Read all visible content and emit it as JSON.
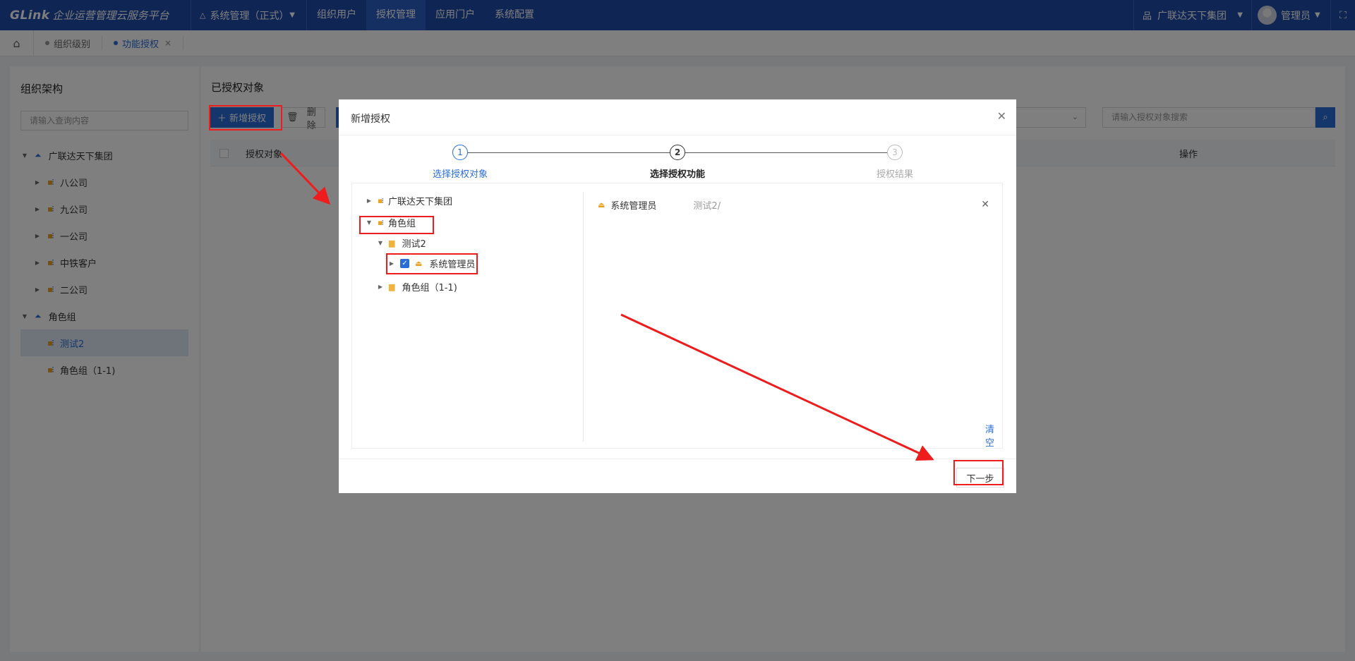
{
  "app": {
    "logo_mark": "GLink",
    "logo_text": "企业运营管理云服务平台",
    "system_select": "系统管理（正式）",
    "nav": [
      "组织用户",
      "授权管理",
      "应用门户",
      "系统配置"
    ],
    "org_switch": "广联达天下集团",
    "user": "管理员"
  },
  "tabs": [
    {
      "label": "组织级别"
    },
    {
      "label": "功能授权",
      "close": "×"
    }
  ],
  "left": {
    "title": "组织架构",
    "search_placeholder": "请输入查询内容",
    "tree": [
      {
        "label": "广联达天下集团"
      },
      {
        "label": "八公司"
      },
      {
        "label": "九公司"
      },
      {
        "label": "一公司"
      },
      {
        "label": "中铁客户"
      },
      {
        "label": "二公司"
      },
      {
        "label": "角色组"
      },
      {
        "label": "测试2"
      },
      {
        "label": "角色组（1-1)"
      }
    ]
  },
  "main": {
    "title": "已授权对象",
    "add_button": "＋ 新增授权",
    "delete_button": "删除",
    "search_placeholder": "请输入授权对象搜索",
    "col_object": "授权对象",
    "col_action": "操作"
  },
  "modal": {
    "title": "新增授权",
    "steps": [
      {
        "num": "1",
        "label": "选择授权对象"
      },
      {
        "num": "2",
        "label": "选择授权功能"
      },
      {
        "num": "3",
        "label": "授权结果"
      }
    ],
    "tree": [
      {
        "label": "广联达天下集团"
      },
      {
        "label": "角色组"
      },
      {
        "label": "测试2"
      },
      {
        "label": "系统管理员"
      },
      {
        "label": "角色组（1-1)"
      }
    ],
    "selected": {
      "name": "系统管理员",
      "path": "测试2/"
    },
    "clear": "清空",
    "next": "下一步"
  }
}
